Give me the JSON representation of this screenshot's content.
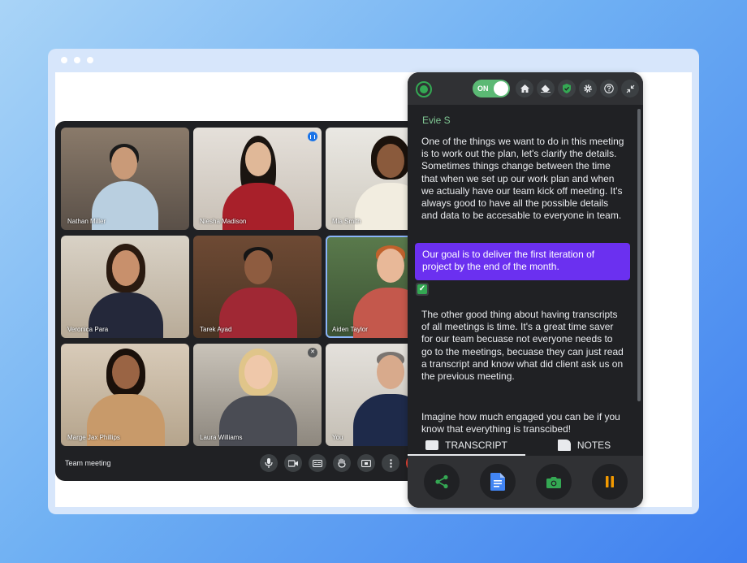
{
  "meet": {
    "title": "Team meeting",
    "participants": [
      {
        "name": "Nathan Miller"
      },
      {
        "name": "Niesha Madison"
      },
      {
        "name": "Mia Smith"
      },
      {
        "name": "Veronica Para"
      },
      {
        "name": "Tarek Ayad"
      },
      {
        "name": "Aiden Taylor"
      },
      {
        "name": "Marge Jax Phillips"
      },
      {
        "name": "Laura Williams"
      },
      {
        "name": "You"
      }
    ],
    "controls": [
      "mic-icon",
      "camera-icon",
      "captions-icon",
      "raise-hand-icon",
      "present-icon",
      "more-icon",
      "end-call-icon"
    ]
  },
  "panel": {
    "toggle_label": "ON",
    "speaker": "Evie S",
    "paragraph_1": "One of the things we want to do in this meeting is to work out the plan, let's clarify the details. Sometimes things change between the time that when we set up our work plan and when we actually have our team kick off meeting. It's always good to have all the possible details and data to be accesable to everyone in team.",
    "highlight": "Our goal is to deliver the first iteration of project by the end of the month.",
    "paragraph_2": "The other good thing about having transcripts of all meetings is time. It's a great time saver for our team becuase not everyone needs to go to the meetings, becuase they can just read a transcript and know what did client ask us on the previous meeting.",
    "paragraph_3": "Imagine how much engaged you can be if you know that everything is transcibed!",
    "tabs": {
      "transcript": "TRANSCRIPT",
      "notes": "NOTES"
    }
  },
  "colors": {
    "accent_green": "#34a853",
    "highlight_purple": "#6b30f0",
    "pause_orange": "#f29900",
    "docs_blue": "#4285f4"
  }
}
